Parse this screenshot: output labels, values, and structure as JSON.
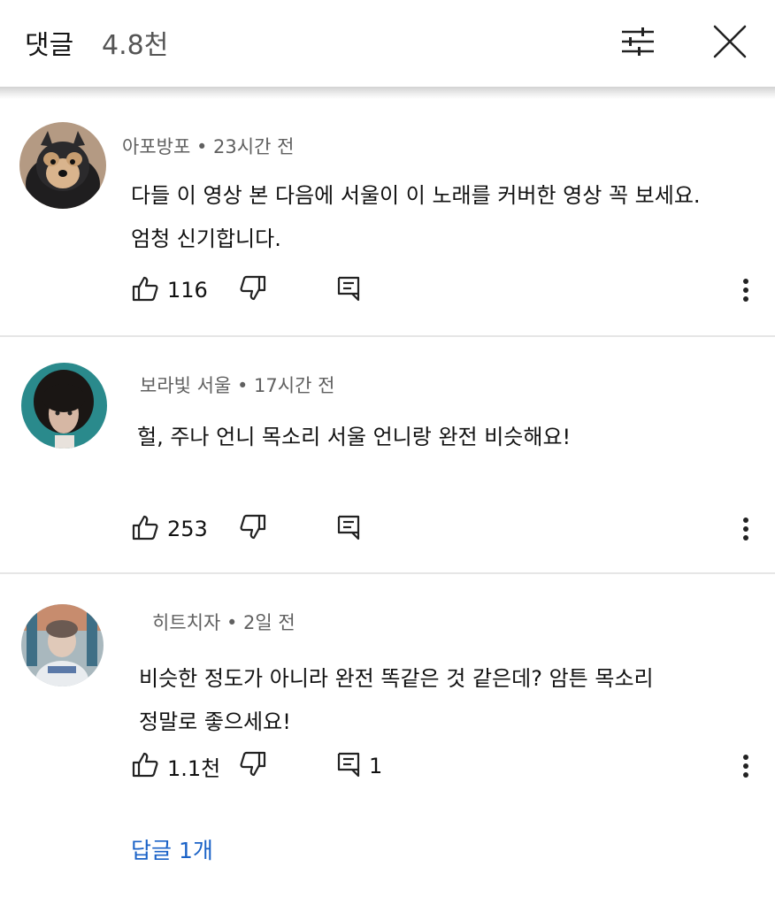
{
  "header": {
    "title": "댓글",
    "count": "4.8천"
  },
  "icons": {
    "filter": "sliders-icon",
    "close": "close-icon",
    "like": "thumbs-up-icon",
    "dislike": "thumbs-down-icon",
    "reply": "reply-comment-icon",
    "more": "more-vertical-icon"
  },
  "comments": [
    {
      "author": "아포방포",
      "time": "23시간 전",
      "text": "다들 이 영상 본 다음에 서울이 이 노래를 커버한 영상 꼭 보세요.\n엄청 신기합니다.",
      "likes": "116",
      "replies": ""
    },
    {
      "author": "보라빛 서울",
      "time": "17시간 전",
      "text": "헐, 주나 언니 목소리 서울 언니랑 완전 비슷해요!",
      "likes": "253",
      "replies": ""
    },
    {
      "author": "히트치자",
      "time": "2일 전",
      "text": "비슷한 정도가 아니라 완전 똑같은 것 같은데? 암튼 목소리\n정말로 좋으세요!",
      "likes": "1.1천",
      "replies": "1"
    }
  ],
  "replies_link": "답글 1개",
  "colors": {
    "link": "#1a62c7",
    "meta": "#606060",
    "divider": "#e6e6e6"
  }
}
